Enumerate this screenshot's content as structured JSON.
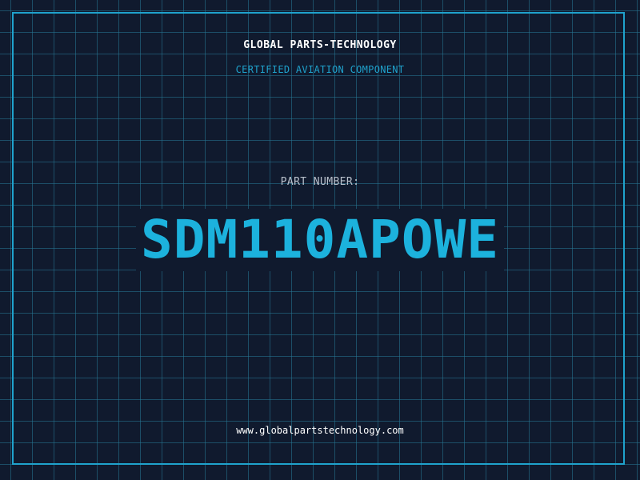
{
  "header": {
    "company": "GLOBAL PARTS-TECHNOLOGY",
    "certification": "CERTIFIED AVIATION COMPONENT"
  },
  "part": {
    "label": "PART NUMBER:",
    "number": "SDM110APOWE"
  },
  "footer": {
    "website": "www.globalpartstechnology.com"
  },
  "colors": {
    "background": "#101a2e",
    "grid": "#267896",
    "accent": "#1fa2cc",
    "part_number": "#1cb2dd",
    "text_primary": "#ffffff",
    "text_muted": "#b9c1cc"
  }
}
